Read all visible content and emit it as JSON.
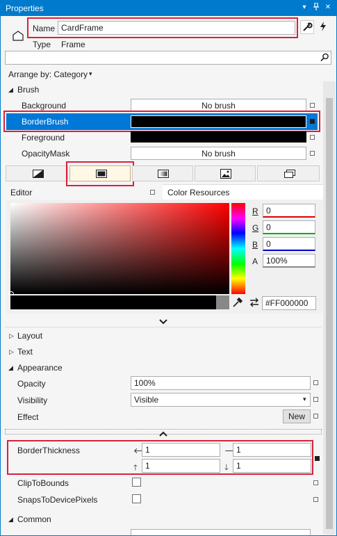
{
  "window": {
    "title": "Properties"
  },
  "header": {
    "name_label": "Name",
    "name_value": "CardFrame",
    "type_label": "Type",
    "type_value": "Frame"
  },
  "search": {
    "value": ""
  },
  "arrange": {
    "label": "Arrange by: Category"
  },
  "brush": {
    "category": "Brush",
    "rows": [
      {
        "name": "Background",
        "value": "No brush"
      },
      {
        "name": "BorderBrush",
        "value": ""
      },
      {
        "name": "Foreground",
        "value": ""
      },
      {
        "name": "OpacityMask",
        "value": "No brush"
      }
    ],
    "tabs": [
      "Null brush",
      "Solid color brush",
      "Gradient brush",
      "Tile brush",
      "Brush resources"
    ]
  },
  "editor": {
    "editor_label": "Editor",
    "color_resources_label": "Color Resources",
    "r_label": "R",
    "r_value": "0",
    "g_label": "G",
    "g_value": "0",
    "b_label": "B",
    "b_value": "0",
    "a_label": "A",
    "a_value": "100%",
    "hex_value": "#FF000000"
  },
  "categories": {
    "layout": "Layout",
    "text": "Text",
    "appearance": "Appearance",
    "common": "Common"
  },
  "appearance": {
    "opacity_label": "Opacity",
    "opacity_value": "100%",
    "visibility_label": "Visibility",
    "visibility_value": "Visible",
    "effect_label": "Effect",
    "effect_button": "New",
    "border_thickness_label": "BorderThickness",
    "thickness_left": "1",
    "thickness_right": "1",
    "thickness_top": "1",
    "thickness_bottom": "1",
    "clip_label": "ClipToBounds",
    "snaps_label": "SnapsToDevicePixels"
  },
  "colors": {
    "accent": "#007acc",
    "highlight": "#d9203a",
    "selected_row": "#0078d7"
  }
}
